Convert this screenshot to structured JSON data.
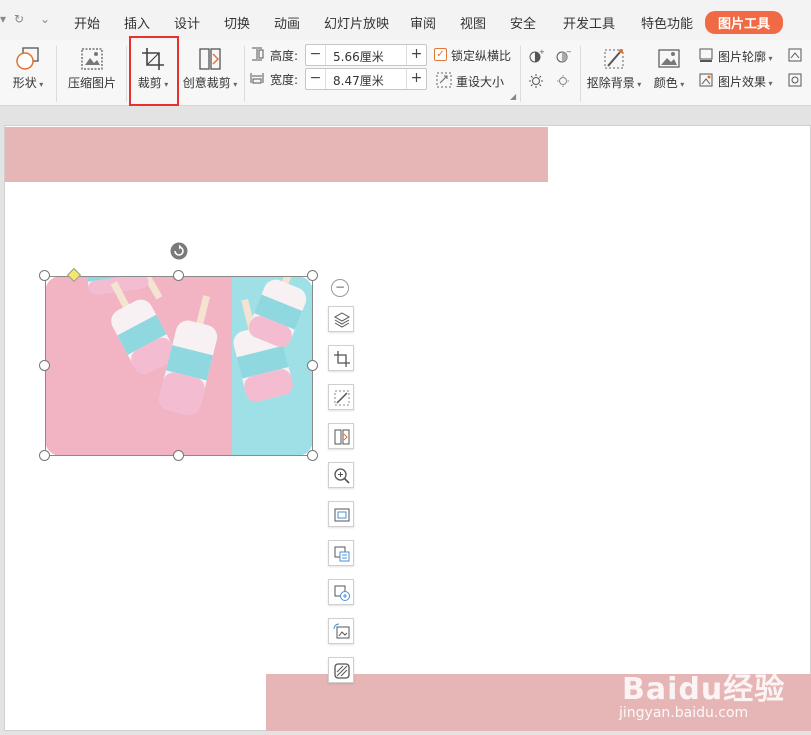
{
  "menubar": {
    "tabs": [
      "开始",
      "插入",
      "设计",
      "切换",
      "动画",
      "幻灯片放映",
      "审阅",
      "视图",
      "安全",
      "开发工具",
      "特色功能"
    ],
    "active_tab": "图片工具"
  },
  "ribbon": {
    "shape_label": "形状",
    "compress_label": "压缩图片",
    "crop_label": "裁剪",
    "creative_crop_label": "创意裁剪",
    "height_label": "高度:",
    "height_value": "5.66厘米",
    "width_label": "宽度:",
    "width_value": "8.47厘米",
    "lock_ratio_label": "锁定纵横比",
    "lock_ratio_checked": true,
    "reset_size_label": "重设大小",
    "remove_bg_label": "抠除背景",
    "color_label": "颜色",
    "outline_label": "图片轮廓",
    "effect_label": "图片效果"
  },
  "colors": {
    "accent": "#ef6a45",
    "highlight": "#e8312e",
    "deco_pink": "#e6b6b6",
    "photo_pink": "#f2b3c2",
    "photo_cyan": "#9ee0e6"
  },
  "floating_toolbar": [
    "layers-icon",
    "crop-icon",
    "remove-bg-icon",
    "creative-crop-icon",
    "zoom-icon",
    "fit-icon",
    "image-to-text-icon",
    "image-translate-icon",
    "replace-image-icon",
    "picture-style-icon"
  ],
  "watermark": {
    "logo": "Baidu经验",
    "url": "jingyan.baidu.com"
  }
}
